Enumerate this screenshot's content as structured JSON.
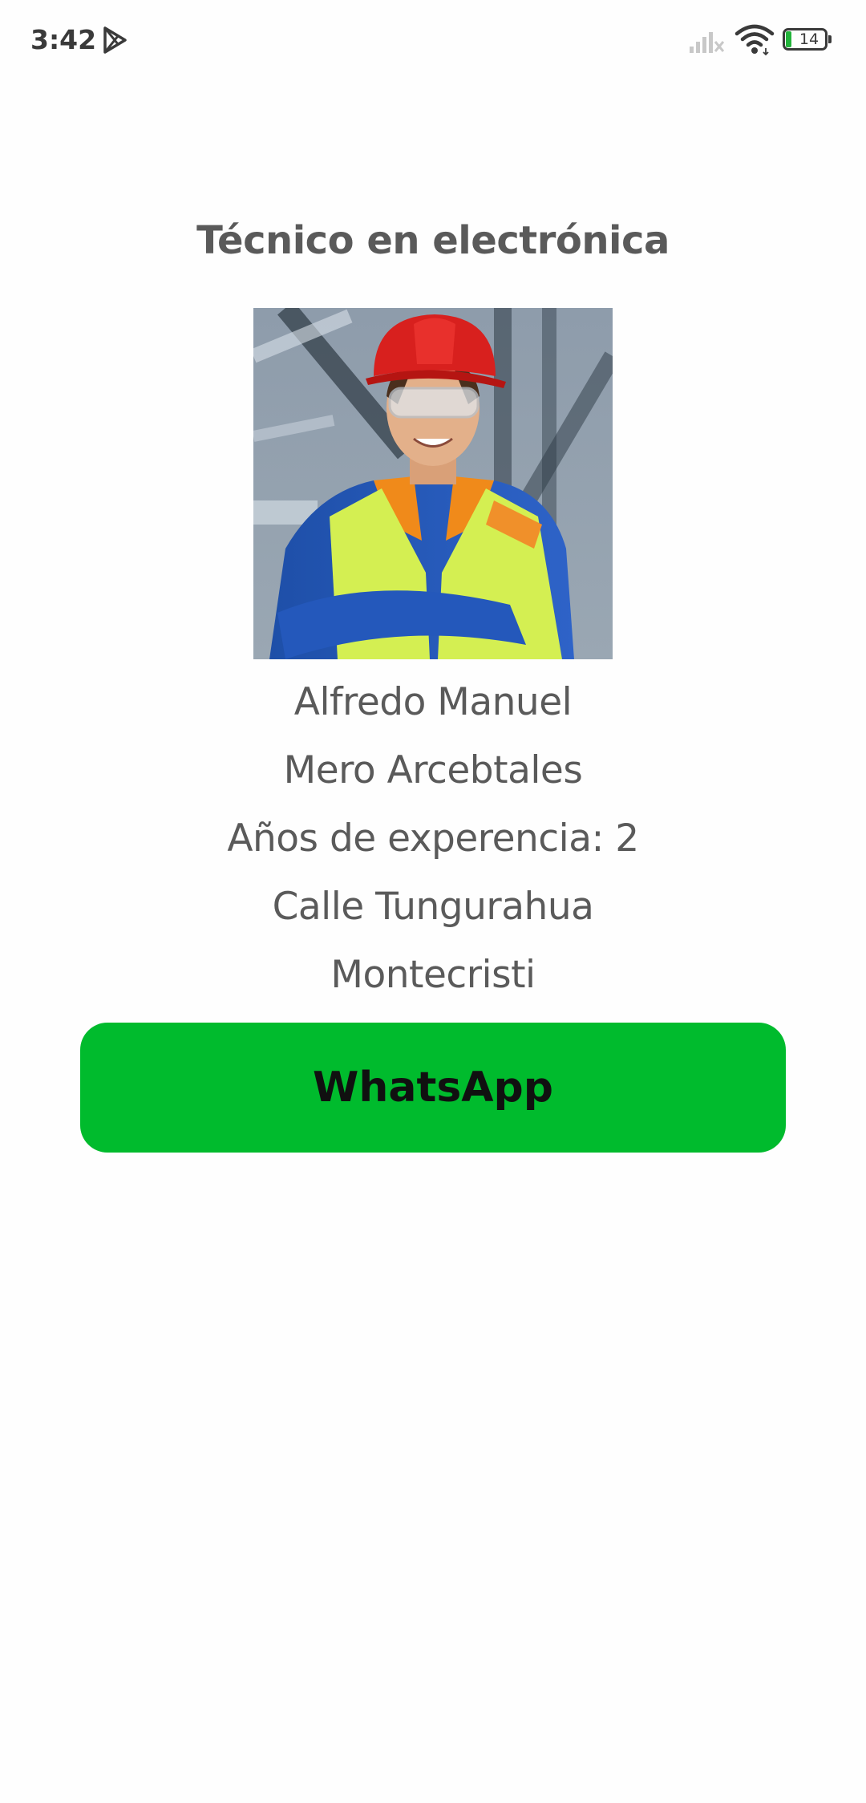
{
  "status_bar": {
    "time": "3:42",
    "battery_level": "14",
    "icons": [
      "play-store-icon",
      "signal-icon",
      "wifi-icon",
      "battery-icon"
    ]
  },
  "profile": {
    "title": "Técnico en electrónica",
    "photo": "worker-portrait",
    "first_name": "Alfredo Manuel",
    "last_name": "Mero Arcebtales",
    "experience": "Años de experencia: 2",
    "address": "Calle Tungurahua",
    "city": "Montecristi"
  },
  "actions": {
    "whatsapp_label": "WhatsApp"
  },
  "colors": {
    "whatsapp_button": "#00bb2d",
    "text": "#5a5a5a",
    "background": "#fefefe"
  }
}
